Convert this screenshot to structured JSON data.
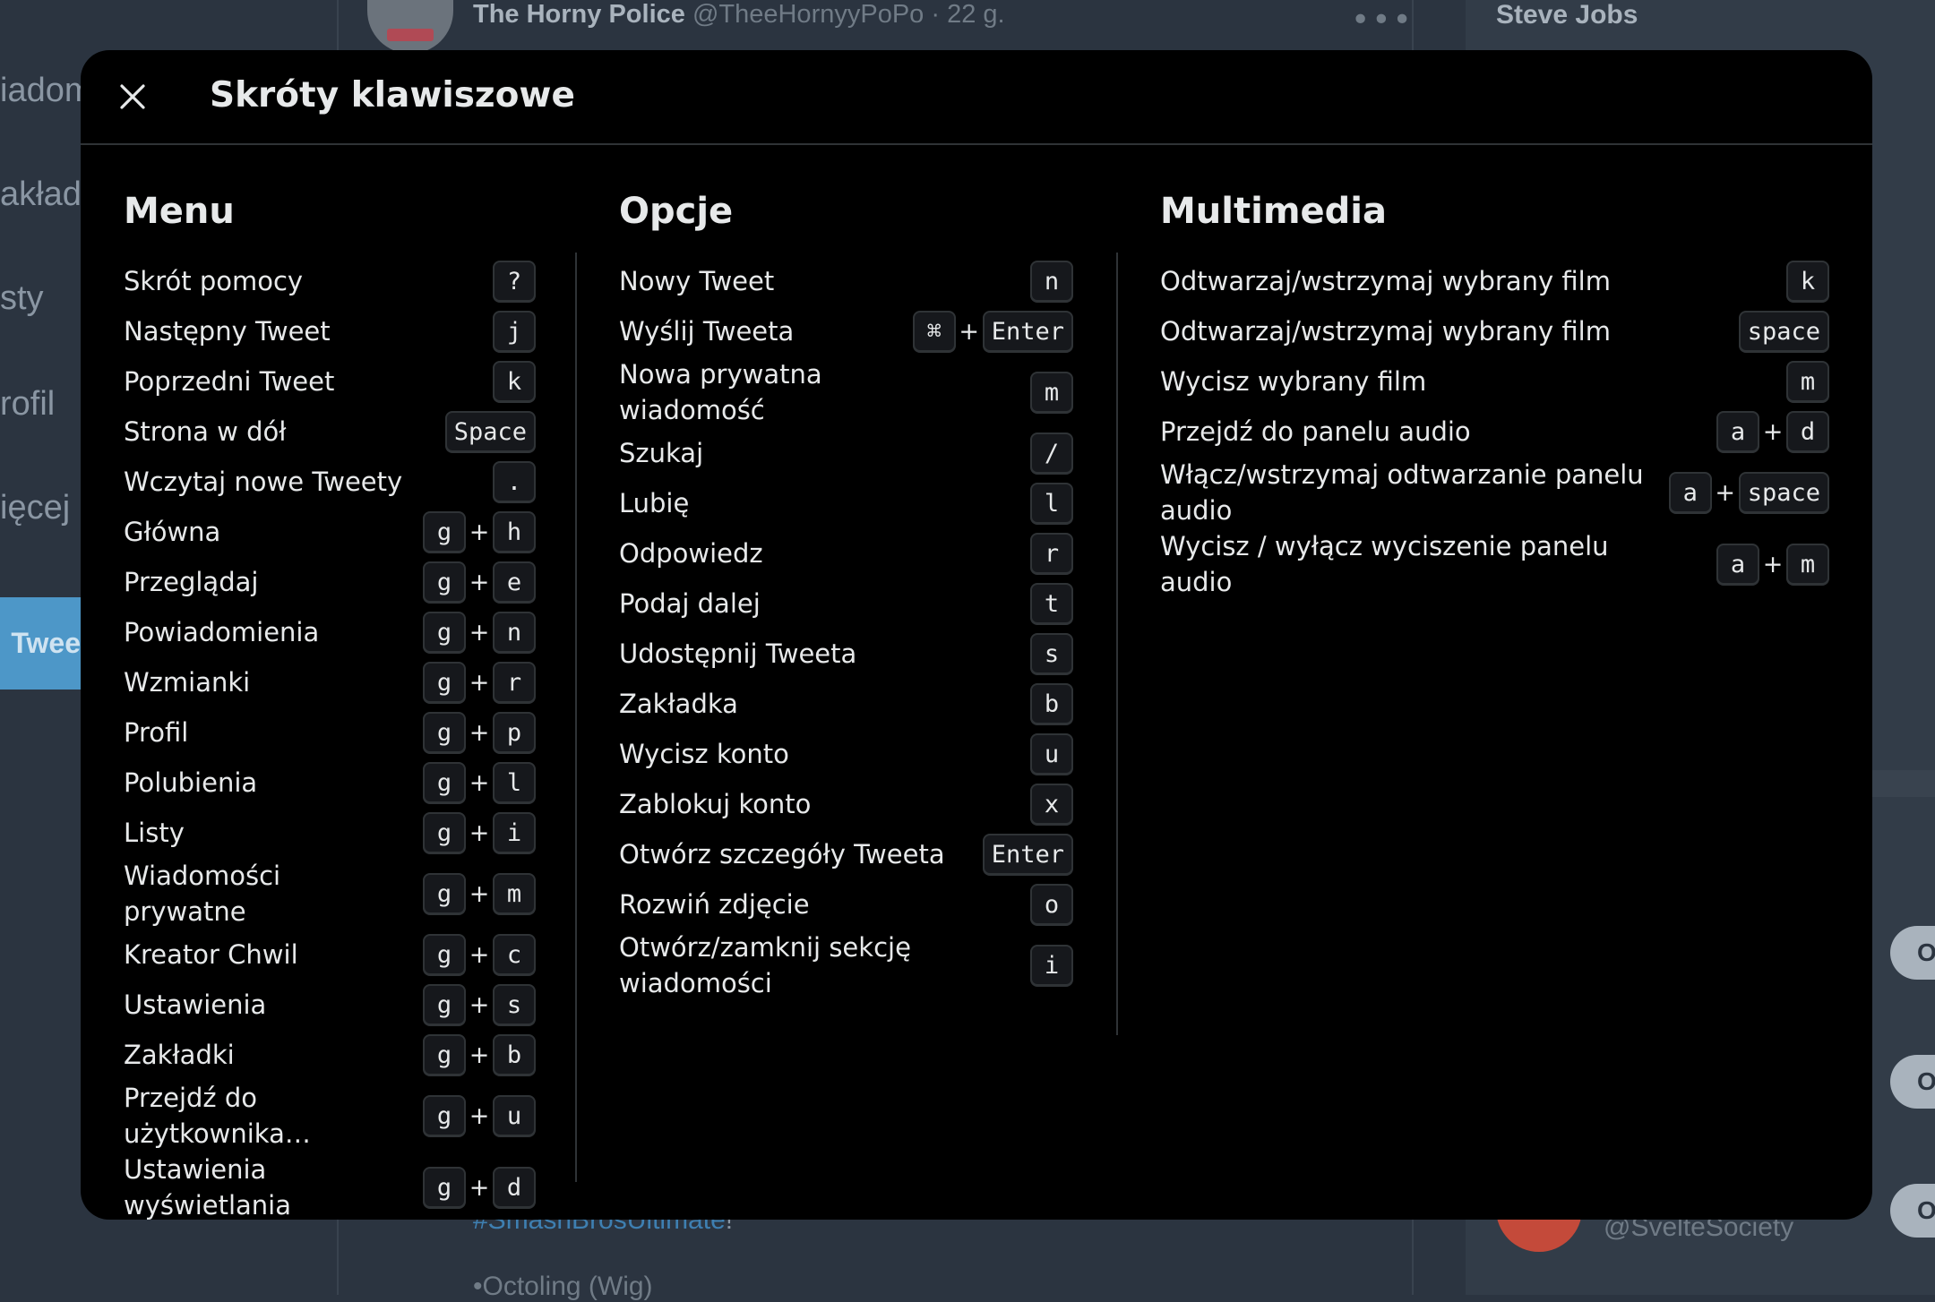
{
  "background": {
    "nav_items": [
      "Wiadomości",
      "Zakładki",
      "Listy",
      "Profil",
      "Więcej"
    ],
    "nav_fragments": [
      "iadom",
      "akładk",
      "sty",
      "rofil",
      "ięcej"
    ],
    "tweet_button": "Twee",
    "tweet_author": "The Horny Police",
    "tweet_handle": "@TheeHornyyPoPo",
    "tweet_time": "· 22 g.",
    "tweet_hashtag": "#SmashBrosUltimate",
    "tweet_hashtag_suffix": "!",
    "tweet_line": "•Octoling (Wig)",
    "right_top_name": "Steve Jobs",
    "right_bottom_handle": "@SvelteSociety",
    "pill_letter": "O"
  },
  "modal": {
    "title": "Skróty klawiszowe",
    "close_icon": "close-icon",
    "columns": {
      "menu": {
        "title": "Menu",
        "items": [
          {
            "label": "Skrót pomocy",
            "keys": [
              "?"
            ]
          },
          {
            "label": "Następny Tweet",
            "keys": [
              "j"
            ]
          },
          {
            "label": "Poprzedni Tweet",
            "keys": [
              "k"
            ]
          },
          {
            "label": "Strona w dół",
            "keys": [
              "Space"
            ]
          },
          {
            "label": "Wczytaj nowe Tweety",
            "keys": [
              "."
            ]
          },
          {
            "label": "Główna",
            "keys": [
              "g",
              "h"
            ]
          },
          {
            "label": "Przeglądaj",
            "keys": [
              "g",
              "e"
            ]
          },
          {
            "label": "Powiadomienia",
            "keys": [
              "g",
              "n"
            ]
          },
          {
            "label": "Wzmianki",
            "keys": [
              "g",
              "r"
            ]
          },
          {
            "label": "Profil",
            "keys": [
              "g",
              "p"
            ]
          },
          {
            "label": "Polubienia",
            "keys": [
              "g",
              "l"
            ]
          },
          {
            "label": "Listy",
            "keys": [
              "g",
              "i"
            ]
          },
          {
            "label": "Wiadomości prywatne",
            "keys": [
              "g",
              "m"
            ]
          },
          {
            "label": "Kreator Chwil",
            "keys": [
              "g",
              "c"
            ]
          },
          {
            "label": "Ustawienia",
            "keys": [
              "g",
              "s"
            ]
          },
          {
            "label": "Zakładki",
            "keys": [
              "g",
              "b"
            ]
          },
          {
            "label": "Przejdź do użytkownika…",
            "keys": [
              "g",
              "u"
            ]
          },
          {
            "label": "Ustawienia wyświetlania",
            "keys": [
              "g",
              "d"
            ]
          }
        ]
      },
      "options": {
        "title": "Opcje",
        "items": [
          {
            "label": "Nowy Tweet",
            "keys": [
              "n"
            ]
          },
          {
            "label": "Wyślij Tweeta",
            "keys": [
              "⌘",
              "Enter"
            ]
          },
          {
            "label": "Nowa prywatna wiadomość",
            "keys": [
              "m"
            ]
          },
          {
            "label": "Szukaj",
            "keys": [
              "/"
            ]
          },
          {
            "label": "Lubię",
            "keys": [
              "l"
            ]
          },
          {
            "label": "Odpowiedz",
            "keys": [
              "r"
            ]
          },
          {
            "label": "Podaj dalej",
            "keys": [
              "t"
            ]
          },
          {
            "label": "Udostępnij Tweeta",
            "keys": [
              "s"
            ]
          },
          {
            "label": "Zakładka",
            "keys": [
              "b"
            ]
          },
          {
            "label": "Wycisz konto",
            "keys": [
              "u"
            ]
          },
          {
            "label": "Zablokuj konto",
            "keys": [
              "x"
            ]
          },
          {
            "label": "Otwórz szczegóły Tweeta",
            "keys": [
              "Enter"
            ]
          },
          {
            "label": "Rozwiń zdjęcie",
            "keys": [
              "o"
            ]
          },
          {
            "label": "Otwórz/zamknij sekcję wiadomości",
            "keys": [
              "i"
            ]
          }
        ]
      },
      "media": {
        "title": "Multimedia",
        "items": [
          {
            "label": "Odtwarzaj/wstrzymaj wybrany film",
            "keys": [
              "k"
            ]
          },
          {
            "label": "Odtwarzaj/wstrzymaj wybrany film",
            "keys": [
              "space"
            ]
          },
          {
            "label": "Wycisz wybrany film",
            "keys": [
              "m"
            ]
          },
          {
            "label": "Przejdź do panelu audio",
            "keys": [
              "a",
              "d"
            ]
          },
          {
            "label": "Włącz/wstrzymaj odtwarzanie panelu audio",
            "keys": [
              "a",
              "space"
            ]
          },
          {
            "label": "Wycisz / wyłącz wyciszenie panelu audio",
            "keys": [
              "a",
              "m"
            ]
          }
        ]
      }
    },
    "key_separator": "+"
  }
}
